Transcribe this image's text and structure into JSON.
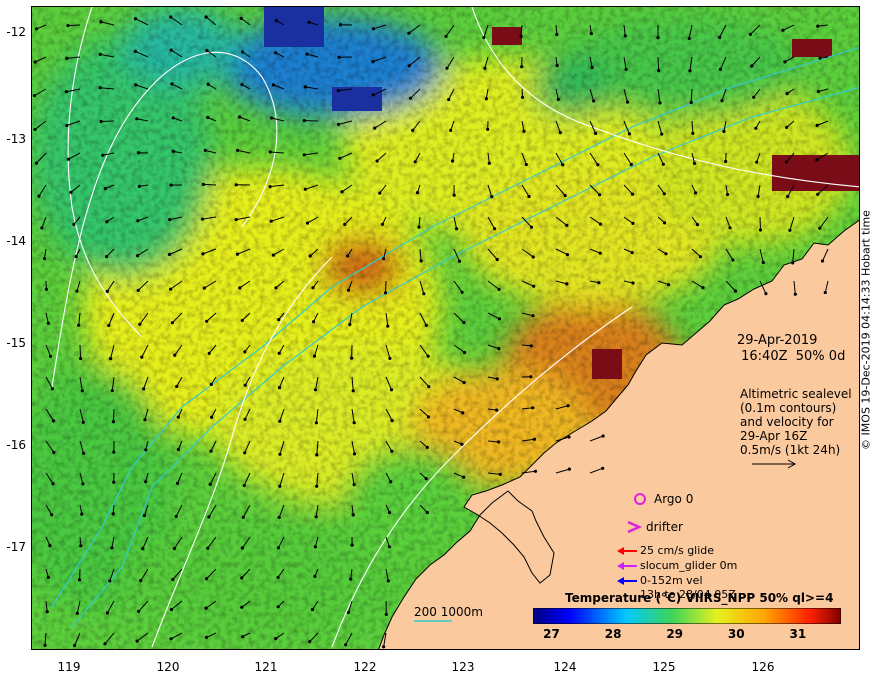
{
  "map": {
    "lat_ticks": [
      "-12",
      "-13",
      "-14",
      "-15",
      "-16",
      "-17"
    ],
    "lon_ticks": [
      "119",
      "120",
      "121",
      "122",
      "123",
      "124",
      "125",
      "126"
    ],
    "lat_range": [
      -12,
      -17.9
    ],
    "lon_range": [
      118.6,
      127.0
    ],
    "colors": {
      "land": "#fbc99e",
      "coast": "#000000",
      "arrow": "#000000",
      "contour": "#ffffff",
      "isobath": "#33cccc"
    }
  },
  "info": {
    "date": "29-Apr-2019",
    "time": " 16:40Z  50% 0d",
    "alt_lines": [
      "Altimetric sealevel",
      "(0.1m contours)",
      "and velocity for",
      "29-Apr 16Z",
      "0.5m/s (1kt 24h)"
    ]
  },
  "legend": {
    "argo": "Argo 0",
    "drifter": "drifter",
    "glide": "25 cm/s glide",
    "slocum": "slocum_glider 0m",
    "vel": "0-152m vel",
    "vel_extra": "13h to 28/04 05Z",
    "isobath": "200  1000m",
    "colors": {
      "argo": "#e020e0",
      "drifter": "#e020e0",
      "glide": "#ff0000",
      "slocum": "#cc22ff",
      "vel": "#0000ff",
      "isobath": "#33cccc"
    }
  },
  "colorbar": {
    "title": "Temperature (°C) VIIRS_NPP 50% ql>=4",
    "labels": [
      "27",
      "28",
      "29",
      "30",
      "31"
    ],
    "range": [
      26.7,
      31.7
    ],
    "label_values": [
      27,
      28,
      29,
      30,
      31
    ]
  },
  "credit": "© IMOS 19-Dec-2019 04:14:33 Hobart time"
}
